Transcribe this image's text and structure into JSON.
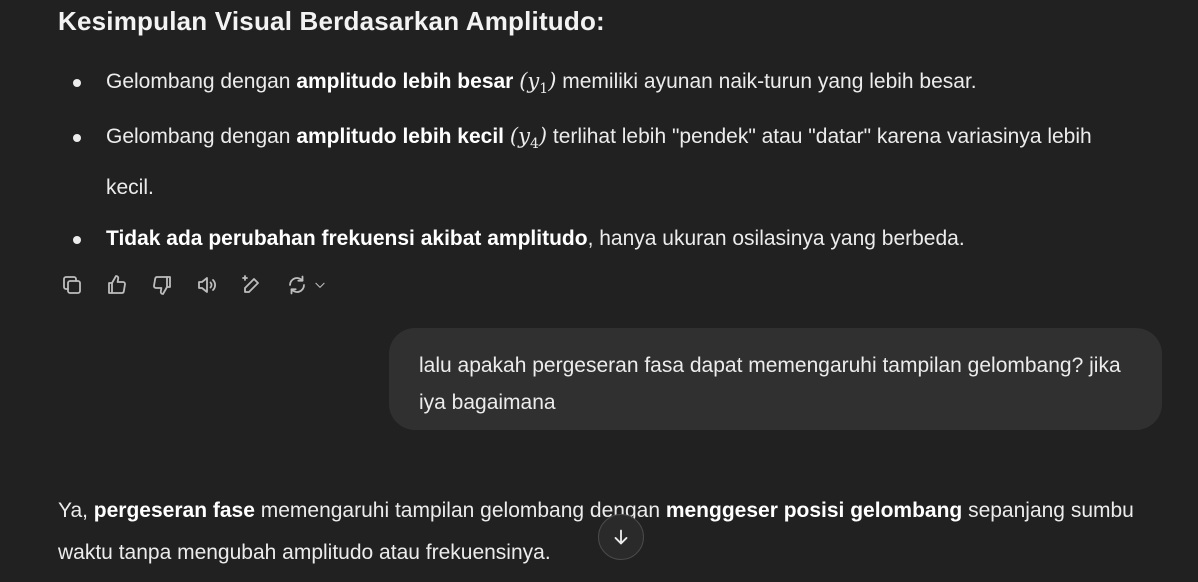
{
  "assistant_previous": {
    "heading": "Kesimpulan Visual Berdasarkan Amplitudo:",
    "bullets": [
      {
        "pre": "Gelombang dengan ",
        "bold": "amplitudo lebih besar",
        "math_var": "y",
        "math_sub": "1",
        "post": " memiliki ayunan naik-turun yang lebih besar."
      },
      {
        "pre": "Gelombang dengan ",
        "bold": "amplitudo lebih kecil",
        "math_var": "y",
        "math_sub": "4",
        "post": " terlihat lebih \"pendek\" atau \"datar\" karena variasinya lebih kecil."
      },
      {
        "bold": "Tidak ada perubahan frekuensi akibat amplitudo",
        "post": ", hanya ukuran osilasinya yang berbeda."
      }
    ]
  },
  "actions": {
    "icons": [
      "copy-icon",
      "thumbs-up-icon",
      "thumbs-down-icon",
      "read-aloud-icon",
      "edit-icon",
      "regenerate-icon",
      "chevron-down-icon"
    ]
  },
  "user_message": {
    "text": "lalu apakah pergeseran fasa dapat memengaruhi tampilan gelombang? jika iya bagaimana"
  },
  "assistant_reply": {
    "pre": "Ya, ",
    "bold1": "pergeseran fase",
    "mid": " memengaruhi tampilan gelombang dengan ",
    "bold2": "menggeser posisi gelombang",
    "post": " sepanjang sumbu waktu tanpa mengubah amplitudo atau frekuensinya."
  },
  "scroll_button": {
    "icon": "arrow-down-icon"
  }
}
